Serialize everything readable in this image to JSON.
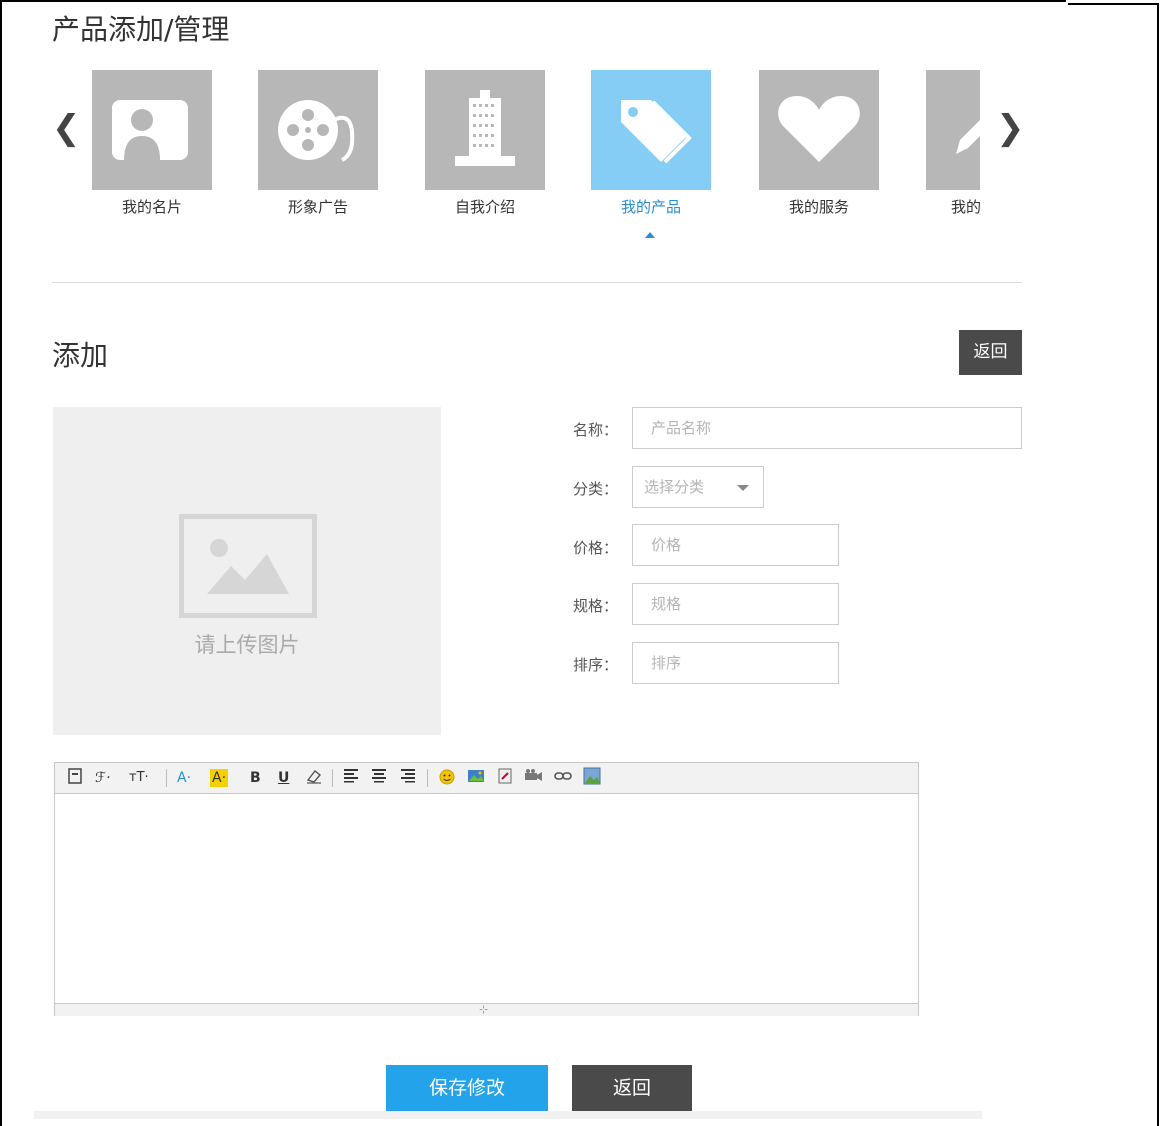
{
  "page_title": "产品添加/管理",
  "carousel": {
    "prev_icon": "chevron-left-icon",
    "next_icon": "chevron-right-icon",
    "items": [
      {
        "label": "我的名片",
        "icon": "profile-card-icon",
        "active": false
      },
      {
        "label": "形象广告",
        "icon": "film-reel-icon",
        "active": false
      },
      {
        "label": "自我介绍",
        "icon": "building-icon",
        "active": false
      },
      {
        "label": "我的产品",
        "icon": "tag-icon",
        "active": true
      },
      {
        "label": "我的服务",
        "icon": "heart-icon",
        "active": false
      },
      {
        "label": "我的",
        "icon": "pencil-icon",
        "active": false
      }
    ]
  },
  "section": {
    "title": "添加",
    "back_label": "返回"
  },
  "upload": {
    "text": "请上传图片",
    "icon": "image-placeholder-icon"
  },
  "form": {
    "name_label": "名称：",
    "name_placeholder": "产品名称",
    "category_label": "分类：",
    "category_value": "选择分类",
    "price_label": "价格：",
    "price_placeholder": "价格",
    "spec_label": "规格：",
    "spec_placeholder": "规格",
    "sort_label": "排序：",
    "sort_placeholder": "排序"
  },
  "editor": {
    "toolbar": {
      "font_size": "тT·",
      "font_color": "A·",
      "highlight": "A·",
      "bold": "B",
      "underline": "U"
    }
  },
  "actions": {
    "save_label": "保存修改",
    "back_label": "返回"
  },
  "colors": {
    "accent": "#22a3ea",
    "active_tile": "#85cdf5",
    "inactive_tile": "#b7b7b7",
    "dark_button": "#4a4a4a"
  }
}
